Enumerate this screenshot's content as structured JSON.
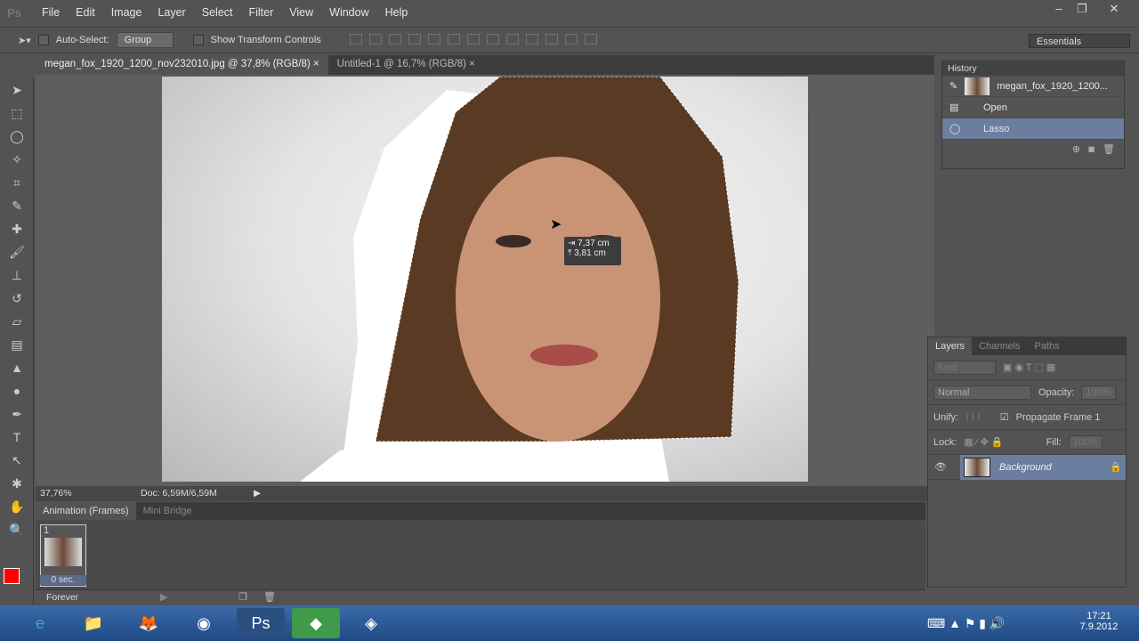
{
  "app": {
    "logo": "Ps"
  },
  "menu": [
    "File",
    "Edit",
    "Image",
    "Layer",
    "Select",
    "Filter",
    "View",
    "Window",
    "Help"
  ],
  "options": {
    "auto_select_label": "Auto-Select:",
    "auto_select_value": "Group",
    "show_transform": "Show Transform Controls",
    "workspace": "Essentials"
  },
  "tabs": [
    {
      "label": "megan_fox_1920_1200_nov232010.jpg @ 37,8% (RGB/8)",
      "close": "×"
    },
    {
      "label": "Untitled-1 @ 16,7% (RGB/8)",
      "close": "×"
    }
  ],
  "tooltip": {
    "w": "7,37 cm",
    "h": "3,81 cm"
  },
  "status": {
    "zoom": "37,76%",
    "doc": "Doc: 6,59M/6,59M"
  },
  "animation": {
    "tabs": [
      "Animation (Frames)",
      "Mini Bridge"
    ],
    "frame_number": "1",
    "frame_delay": "0 sec.",
    "loop": "Forever"
  },
  "history": {
    "title": "History",
    "items": [
      "megan_fox_1920_1200...",
      "Open",
      "Lasso"
    ],
    "selected": "Lasso"
  },
  "layers": {
    "tabs": [
      "Layers",
      "Channels",
      "Paths"
    ],
    "kind": "Kind",
    "blend": "Normal",
    "opacity_label": "Opacity:",
    "opacity_value": "100%",
    "unify_label": "Unify:",
    "propagate": "Propagate Frame 1",
    "lock_label": "Lock:",
    "fill_label": "Fill:",
    "fill_value": "100%",
    "layer_name": "Background"
  },
  "taskbar": {
    "time": "17:21",
    "date": "7.9.2012"
  },
  "colors": {
    "foreground": "#ff0000",
    "background": "#ffffff",
    "selected_row": "#6b7ea0"
  }
}
